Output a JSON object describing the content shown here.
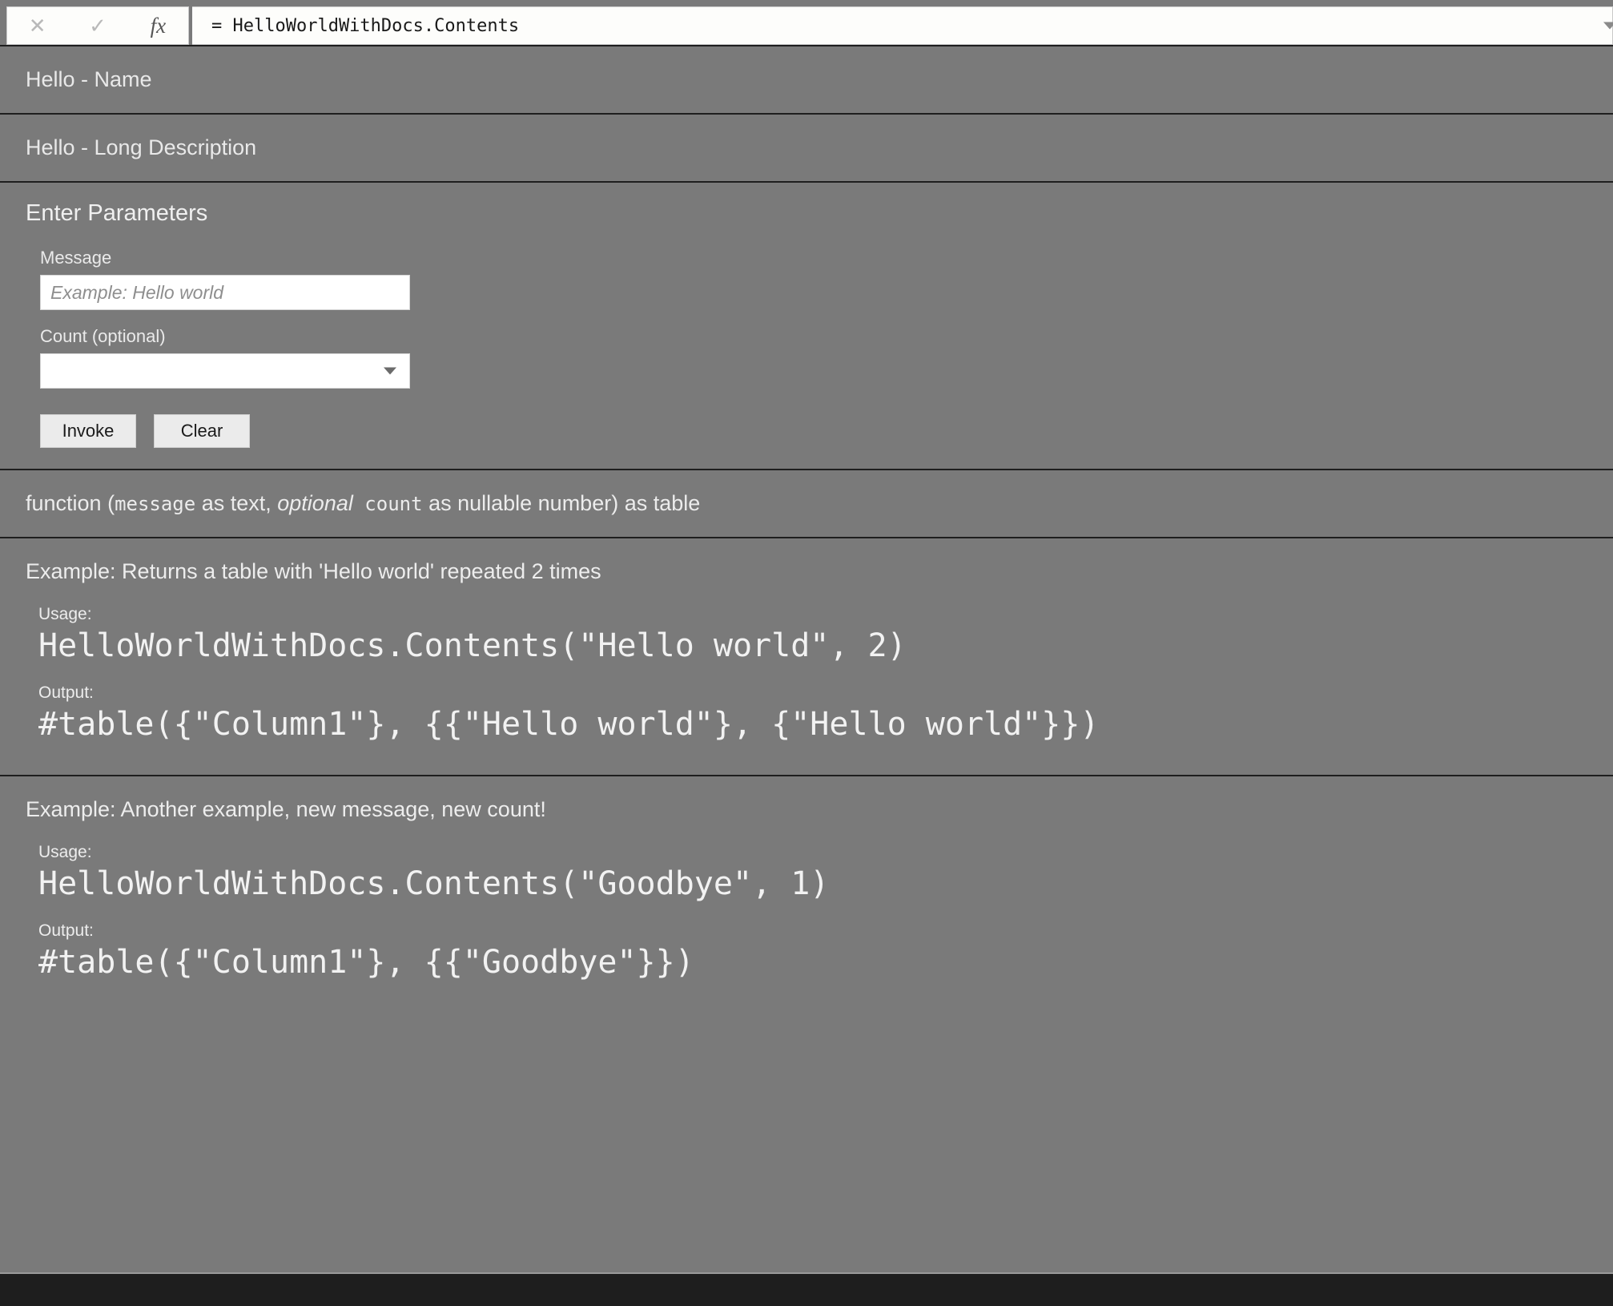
{
  "formula_bar": {
    "cancel_icon": "close-icon",
    "accept_icon": "check-icon",
    "fx_label": "fx",
    "formula_value": "= HelloWorldWithDocs.Contents",
    "formula_placeholder": "",
    "expand_icon": "chevron-down-icon"
  },
  "header": {
    "name": "Hello - Name",
    "long_description": "Hello - Long Description"
  },
  "parameters": {
    "heading": "Enter Parameters",
    "fields": [
      {
        "label": "Message",
        "type": "text",
        "value": "",
        "placeholder": "Example: Hello world"
      },
      {
        "label": "Count (optional)",
        "type": "dropdown",
        "value": "",
        "placeholder": ""
      }
    ],
    "invoke_label": "Invoke",
    "clear_label": "Clear"
  },
  "signature": {
    "prefix": "function (",
    "param1": "message",
    "param1_type": " as text, ",
    "optional_word": "optional",
    "param2": " count",
    "param2_type": " as nullable number) as table",
    "full_text": "function (message as text, optional count as nullable number) as table"
  },
  "examples": [
    {
      "title": "Example: Returns a table with 'Hello world' repeated 2 times",
      "usage_label": "Usage:",
      "usage_code": "HelloWorldWithDocs.Contents(\"Hello world\", 2)",
      "output_label": "Output:",
      "output_code": "#table({\"Column1\"}, {{\"Hello world\"}, {\"Hello world\"}})"
    },
    {
      "title": "Example: Another example, new message, new count!",
      "usage_label": "Usage:",
      "usage_code": "HelloWorldWithDocs.Contents(\"Goodbye\", 1)",
      "output_label": "Output:",
      "output_code": "#table({\"Column1\"}, {{\"Goodbye\"}})"
    }
  ],
  "colors": {
    "background": "#7a7a7a",
    "divider": "#1e1e1e",
    "text": "#ededed",
    "input_background": "#ffffff",
    "button_background": "#ebebeb",
    "bottom_bar": "#1e1e1e"
  }
}
